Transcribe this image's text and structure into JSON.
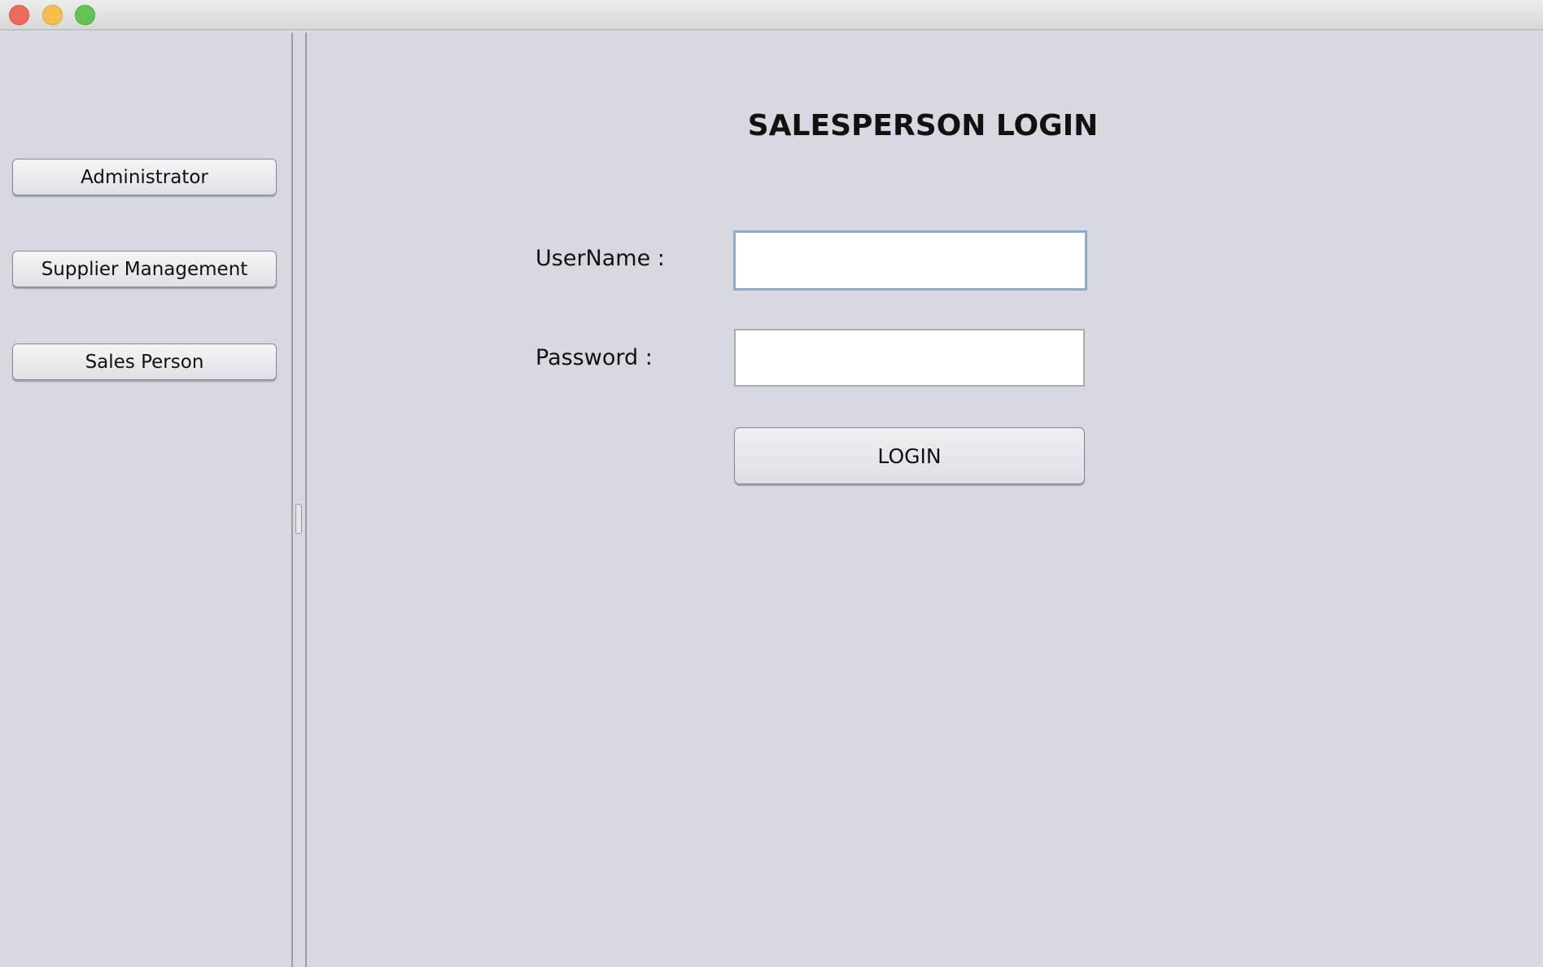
{
  "window": {
    "controls": [
      {
        "name": "close",
        "color": "#ec6a5e"
      },
      {
        "name": "minimize",
        "color": "#f5bf4f"
      },
      {
        "name": "maximize",
        "color": "#61c554"
      }
    ]
  },
  "sidebar": {
    "items": [
      {
        "label": "Administrator"
      },
      {
        "label": "Supplier Management"
      },
      {
        "label": "Sales Person"
      }
    ]
  },
  "main": {
    "title": "SALESPERSON LOGIN",
    "username": {
      "label": "UserName :",
      "value": ""
    },
    "password": {
      "label": "Password :",
      "value": ""
    },
    "login_label": "LOGIN"
  }
}
